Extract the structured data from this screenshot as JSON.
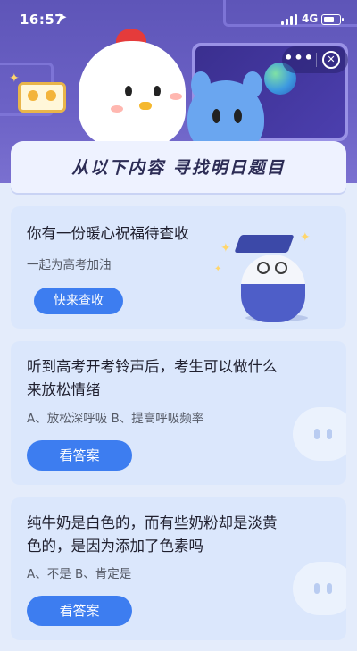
{
  "status_bar": {
    "time": "16:57",
    "network": "4G"
  },
  "mini_program": {
    "more_label": "•••",
    "close_label": "✕"
  },
  "banner": {
    "title": "从以下内容 寻找明日题目"
  },
  "cards": [
    {
      "title": "你有一份暖心祝福待查收",
      "subtitle": "一起为高考加油",
      "button_label": "快来查收"
    },
    {
      "title_line1": "听到高考开考铃声后，考生可以做什么",
      "title_line2": "来放松情绪",
      "options": "A、放松深呼吸     B、提高呼吸频率",
      "button_label": "看答案"
    },
    {
      "title_line1": "纯牛奶是白色的，而有些奶粉却是淡黄",
      "title_line2": "色的，是因为添加了色素吗",
      "options": "A、不是     B、肯定是",
      "button_label": "看答案"
    }
  ],
  "colors": {
    "header_bg": "#6c62c6",
    "card_bg": "#dbe7fc",
    "button_bg": "#3d7df0",
    "page_bg": "#e4ecfb"
  },
  "icons": [
    "location-arrow-icon",
    "signal-icon",
    "battery-icon",
    "more-icon",
    "close-icon"
  ]
}
